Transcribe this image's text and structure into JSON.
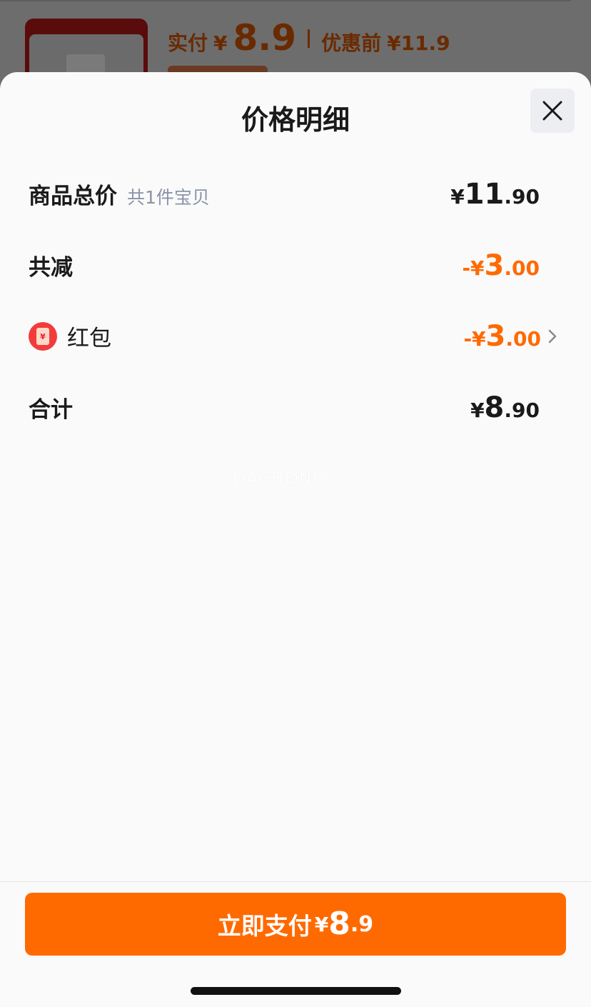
{
  "background": {
    "paid_label": "实付",
    "paid_symbol": "¥",
    "paid_amount": "8.9",
    "original_label": "优惠前",
    "original_price": "¥11.9"
  },
  "sheet": {
    "title": "价格明细"
  },
  "rows": {
    "subtotal": {
      "label": "商品总价",
      "sublabel": "共1件宝贝",
      "symbol": "¥",
      "int": "11",
      "dec": ".90"
    },
    "discount": {
      "label": "共减",
      "symbol": "-¥",
      "int": "3",
      "dec": ".00"
    },
    "red_packet": {
      "label": "红包",
      "symbol": "-¥",
      "int": "3",
      "dec": ".00",
      "icon": "red-packet-icon"
    },
    "total": {
      "label": "合计",
      "symbol": "¥",
      "int": "8",
      "dec": ".90"
    }
  },
  "watermark": "DACHONG",
  "pay_button": {
    "label": "立即支付",
    "symbol": "¥",
    "int": "8",
    "dec": ".9"
  },
  "colors": {
    "accent": "#ff6a00",
    "text": "#1a1a1a",
    "muted": "#8a94a8"
  }
}
